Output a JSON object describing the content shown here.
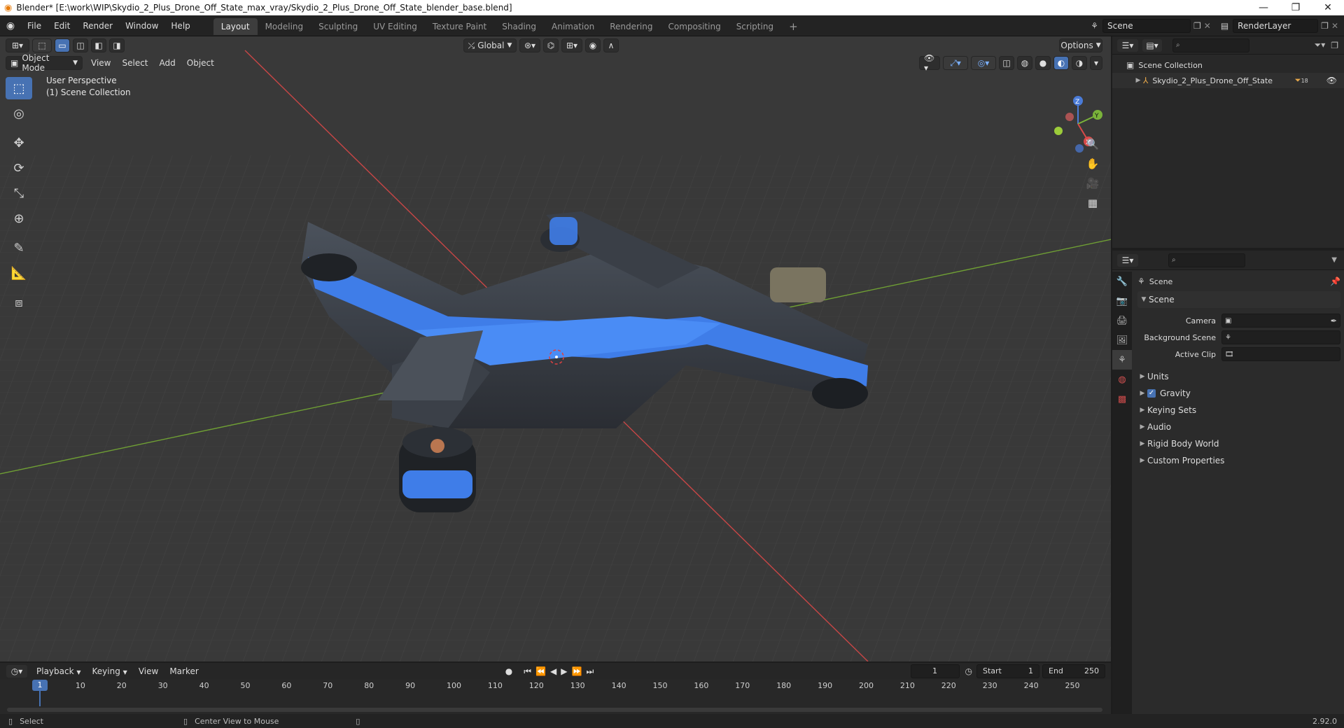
{
  "window": {
    "title": "Blender* [E:\\work\\WIP\\Skydio_2_Plus_Drone_Off_State_max_vray/Skydio_2_Plus_Drone_Off_State_blender_base.blend]",
    "controls": [
      "minimize-icon",
      "restore-icon",
      "close-icon"
    ]
  },
  "menubar": {
    "menus": [
      "File",
      "Edit",
      "Render",
      "Window",
      "Help"
    ],
    "workspaces": [
      "Layout",
      "Modeling",
      "Sculpting",
      "UV Editing",
      "Texture Paint",
      "Shading",
      "Animation",
      "Rendering",
      "Compositing",
      "Scripting"
    ],
    "active_workspace": "Layout",
    "add_tab": "+",
    "scene": "Scene",
    "view_layer": "RenderLayer"
  },
  "viewport": {
    "mode": "Object Mode",
    "menus": [
      "View",
      "Select",
      "Add",
      "Object"
    ],
    "transform_orientation": "Global",
    "options_label": "Options",
    "overlay_title": "User Perspective",
    "overlay_collection": "(1) Scene Collection",
    "gizmo": {
      "x": "X",
      "y": "Y",
      "z": "Z"
    },
    "colors": {
      "bg": "#393939",
      "x_axis": "#d94a4a",
      "y_axis": "#7ab33a",
      "active_tool": "#4772b3"
    }
  },
  "outliner": {
    "root": "Scene Collection",
    "items": [
      {
        "label": "Skydio_2_Plus_Drone_Off_State",
        "badge": "18"
      }
    ]
  },
  "properties": {
    "header": "Scene",
    "panel_title": "Scene",
    "fields": [
      {
        "label": "Camera",
        "value": ""
      },
      {
        "label": "Background Scene",
        "value": ""
      },
      {
        "label": "Active Clip",
        "value": ""
      }
    ],
    "subpanels": [
      {
        "label": "Units",
        "checkbox": false
      },
      {
        "label": "Gravity",
        "checkbox": true
      },
      {
        "label": "Keying Sets",
        "checkbox": false
      },
      {
        "label": "Audio",
        "checkbox": false
      },
      {
        "label": "Rigid Body World",
        "checkbox": false
      },
      {
        "label": "Custom Properties",
        "checkbox": false
      }
    ]
  },
  "timeline": {
    "menus": [
      "Playback",
      "Keying",
      "View",
      "Marker"
    ],
    "current_frame": "1",
    "start_label": "Start",
    "start": "1",
    "end_label": "End",
    "end": "250",
    "ticks": [
      "10",
      "20",
      "30",
      "40",
      "50",
      "60",
      "70",
      "80",
      "90",
      "100",
      "110",
      "120",
      "130",
      "140",
      "150",
      "160",
      "170",
      "180",
      "190",
      "200",
      "210",
      "220",
      "230",
      "240",
      "250"
    ]
  },
  "statusbar": {
    "left_action": "Select",
    "middle_action": "Center View to Mouse",
    "version": "2.92.0"
  }
}
